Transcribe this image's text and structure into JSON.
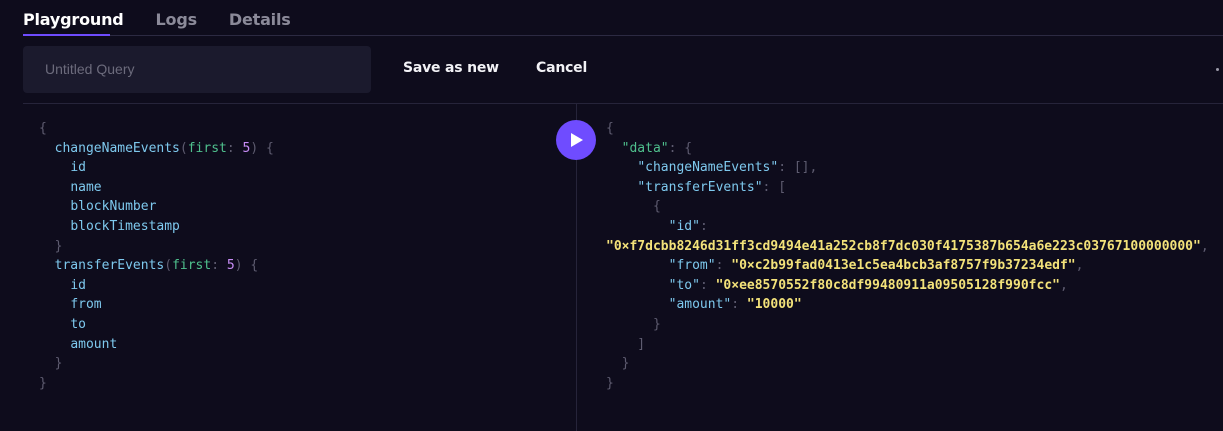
{
  "tabs": [
    {
      "label": "Playground",
      "active": true
    },
    {
      "label": "Logs",
      "active": false
    },
    {
      "label": "Details",
      "active": false
    }
  ],
  "toolbar": {
    "query_name_placeholder": "Untitled Query",
    "save_label": "Save as new",
    "cancel_label": "Cancel"
  },
  "colors": {
    "accent": "#6f4cff",
    "background": "#0e0c1c",
    "field": "#7ec9ee",
    "arg": "#4fc08d",
    "number": "#c78cf5",
    "string": "#f3e27a"
  },
  "query": {
    "open_brace": "{",
    "close_brace": "}",
    "blocks": [
      {
        "name": "changeNameEvents",
        "arg_name": "first",
        "arg_value": "5",
        "fields": [
          "id",
          "name",
          "blockNumber",
          "blockTimestamp"
        ]
      },
      {
        "name": "transferEvents",
        "arg_name": "first",
        "arg_value": "5",
        "fields": [
          "id",
          "from",
          "to",
          "amount"
        ]
      }
    ]
  },
  "result": {
    "data_key": "\"data\"",
    "change_key": "\"changeNameEvents\"",
    "change_value": "[]",
    "transfer_key": "\"transferEvents\"",
    "item": {
      "id_key": "\"id\"",
      "id_value": "\"0×f7dcbb8246d31ff3cd9494e41a252cb8f7dc030f4175387b654a6e223c03767100000000\"",
      "from_key": "\"from\"",
      "from_value": "\"0×c2b99fad0413e1c5ea4bcb3af8757f9b37234edf\"",
      "to_key": "\"to\"",
      "to_value": "\"0×ee8570552f80c8df99480911a09505128f990fcc\"",
      "amount_key": "\"amount\"",
      "amount_value": "\"10000\""
    }
  }
}
